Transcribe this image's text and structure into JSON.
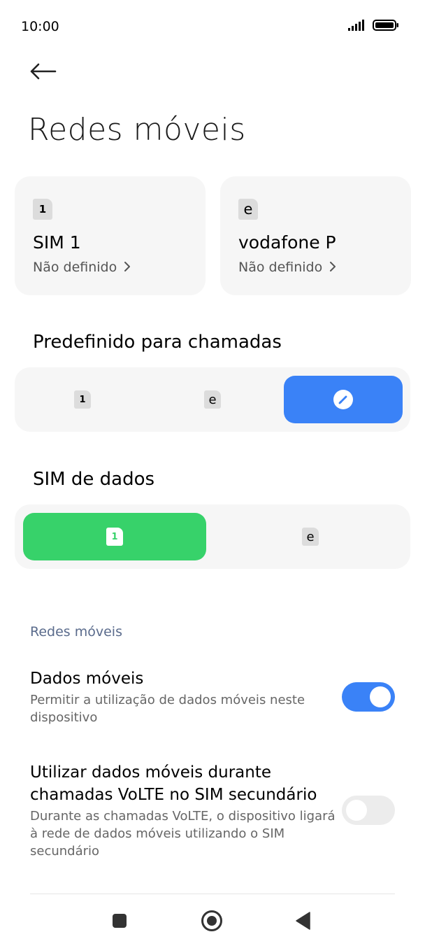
{
  "status_bar": {
    "time": "10:00"
  },
  "header": {
    "title": "Redes móveis"
  },
  "sims": [
    {
      "chip": "1",
      "name": "SIM 1",
      "status": "Não definido"
    },
    {
      "chip": "e",
      "name": "vodafone P",
      "status": "Não definido"
    }
  ],
  "calls": {
    "title": "Predefinido para chamadas",
    "options": [
      {
        "chip": "1"
      },
      {
        "chip": "e"
      },
      {
        "icon": "ask-every-time-icon"
      }
    ],
    "selected_index": 2
  },
  "data_sim": {
    "title": "SIM de dados",
    "options": [
      {
        "chip": "1"
      },
      {
        "chip": "e"
      }
    ],
    "selected_index": 0
  },
  "mobile_networks": {
    "section_label": "Redes móveis",
    "settings": [
      {
        "title": "Dados móveis",
        "description": "Permitir a utilização de dados móveis neste dispositivo",
        "enabled": true
      },
      {
        "title": "Utilizar dados móveis durante chamadas VoLTE no SIM secundário",
        "description": "Durante as chamadas VoLTE, o dispositivo ligará à rede de dados móveis utilizando o SIM secundário",
        "enabled": false
      }
    ]
  },
  "colors": {
    "accent_blue": "#3a82f7",
    "accent_green": "#37d26a"
  }
}
